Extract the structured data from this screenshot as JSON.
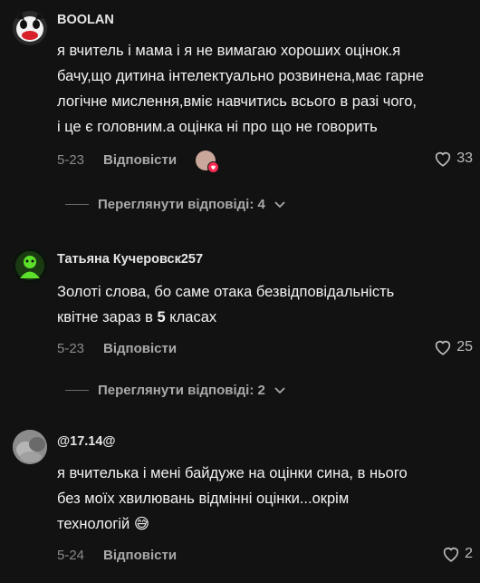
{
  "comments": [
    {
      "username": "BOOLAN",
      "text": "я вчитель і мама і я не вимагаю хороших оцінок.я\nбачу,що дитина інтелектуально розвинена,має гарне\nлогічне мислення,вміє навчитись всього в разі чого,\nі це є головним.а оцінка ні про що не говорить",
      "date": "5-23",
      "reply_label": "Відповісти",
      "likes": "33",
      "view_replies": "Переглянути відповіді: 4"
    },
    {
      "username": "Татьяна Кучеровск257",
      "text_part1": "Золоті слова, бо саме отака безвідповідальність\nквітне зараз в ",
      "text_bold": "5",
      "text_part2": " класах",
      "date": "5-23",
      "reply_label": "Відповісти",
      "likes": "25",
      "view_replies": "Переглянути відповіді: 2"
    },
    {
      "username": "@17.14@",
      "text": "я вчителька і мені байдуже на оцінки сина, в нього\nбез моїх хвилювань відмінні оцінки...окрім\nтехнологій 😅",
      "date": "5-24",
      "reply_label": "Відповісти",
      "likes": "2"
    }
  ],
  "colors": {
    "background": "#121212",
    "text": "#f2f2f2",
    "muted": "#8a8a8a",
    "accent_heart": "#fe2c55"
  }
}
